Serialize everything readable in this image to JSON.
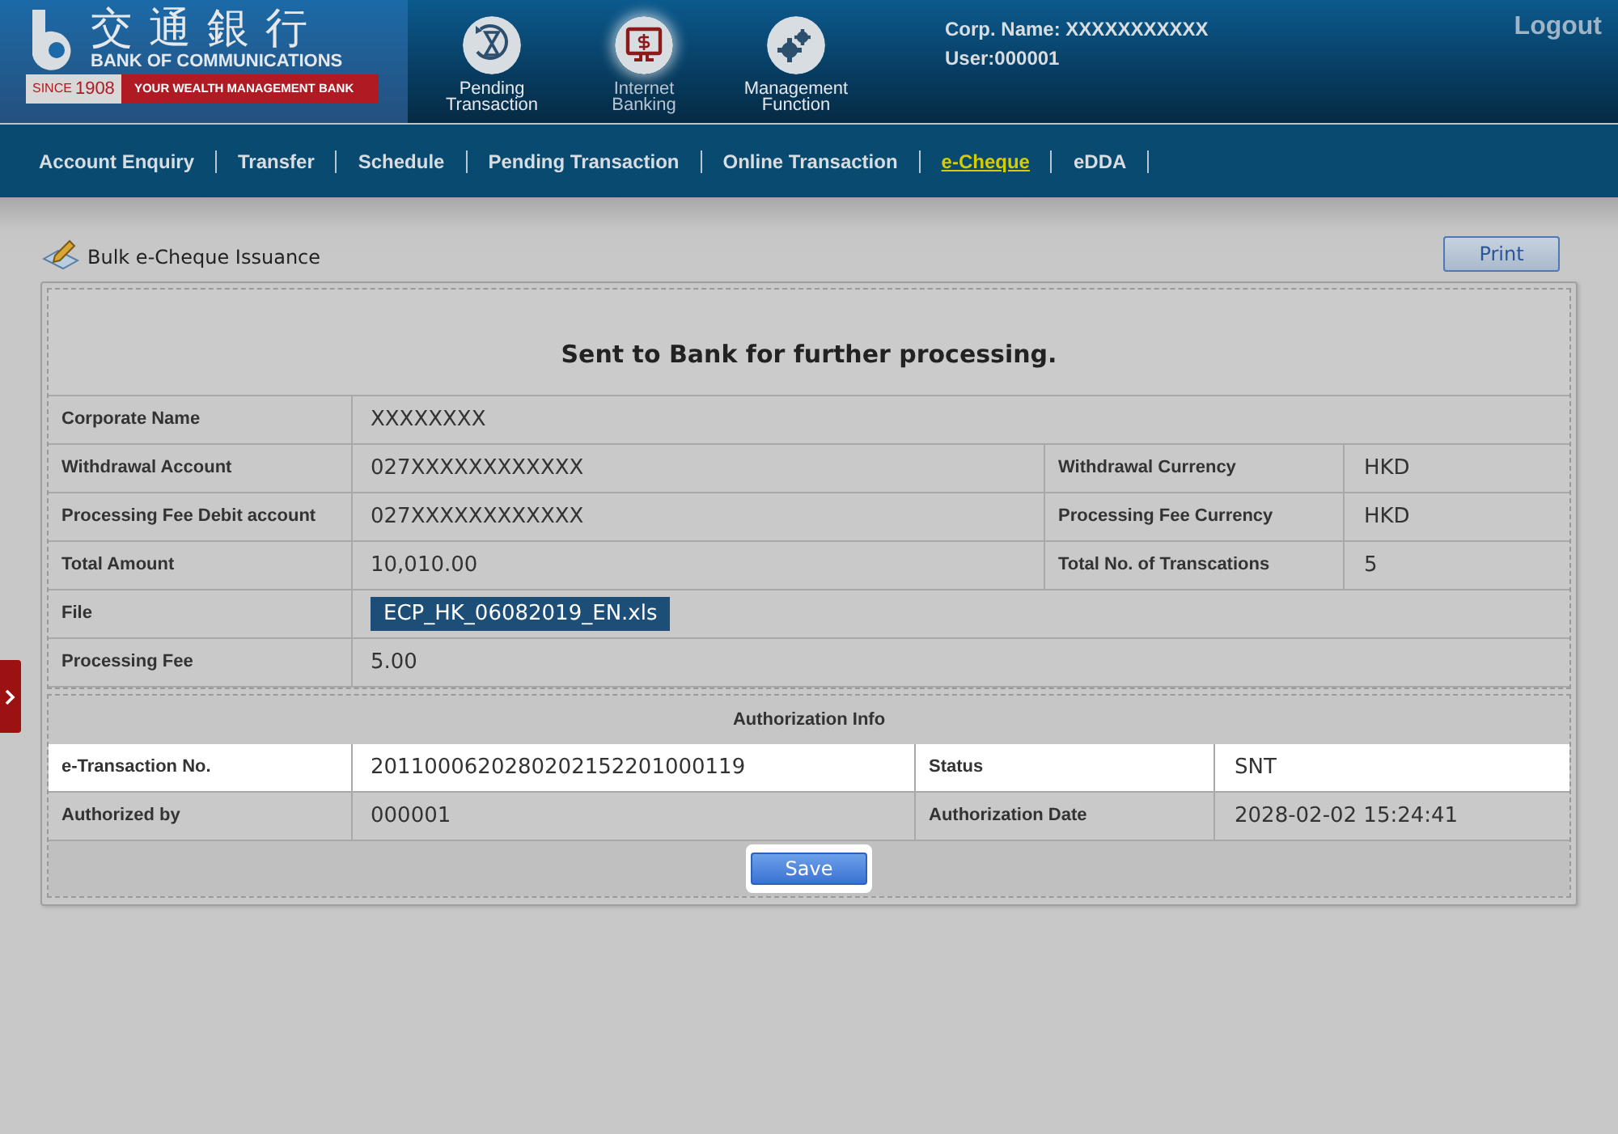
{
  "header": {
    "logo": {
      "chinese": "交通銀行",
      "english": "BANK OF COMMUNICATIONS",
      "since": "SINCE",
      "year": "1908",
      "slogan": "YOUR WEALTH MANAGEMENT BANK"
    },
    "shortcuts": [
      {
        "label": "Pending Transaction",
        "kind": "hourglass",
        "selected": false
      },
      {
        "label": "Internet Banking",
        "kind": "monitor",
        "selected": true
      },
      {
        "label": "Management Function",
        "kind": "gears",
        "selected": false
      }
    ],
    "corp_name": "Corp. Name: XXXXXXXXXXX",
    "user": "User:000001",
    "logout": "Logout"
  },
  "nav": [
    {
      "label": "Account Enquiry",
      "selected": false
    },
    {
      "label": "Transfer",
      "selected": false
    },
    {
      "label": "Schedule",
      "selected": false
    },
    {
      "label": "Pending Transaction",
      "selected": false
    },
    {
      "label": "Online Transaction",
      "selected": false
    },
    {
      "label": "e-Cheque",
      "selected": true
    },
    {
      "label": "eDDA",
      "selected": false
    }
  ],
  "page": {
    "title": "Bulk e-Cheque Issuance",
    "print": "Print"
  },
  "result": {
    "message": "Sent to Bank for further processing.",
    "rows": [
      {
        "kind": "text",
        "label": "Corporate Name",
        "value": "XXXXXXXX"
      },
      {
        "kind": "text",
        "label": "Withdrawal Account",
        "value": "027XXXXXXXXXXXX",
        "label_2": "Withdrawal Currency",
        "value_2": "HKD"
      },
      {
        "kind": "text",
        "label": "Processing Fee Debit account",
        "value": "027XXXXXXXXXXXX",
        "label_2": "Processing Fee Currency",
        "value_2": "HKD"
      },
      {
        "kind": "text",
        "label": "Total Amount",
        "value": "10,010.00",
        "label_2": "Total No. of Transcations",
        "value_2": "5"
      },
      {
        "kind": "file",
        "label": "File",
        "value": "ECP_HK_06082019_EN.xls"
      },
      {
        "kind": "text",
        "label": "Processing Fee",
        "value": "5.00"
      }
    ]
  },
  "authorization": {
    "title": "Authorization Info",
    "rows": [
      {
        "label": "e-Transaction No.",
        "value": "2011000620280202152201000119",
        "label_2": "Status",
        "value_2": "SNT",
        "highlighted": true
      },
      {
        "label": "Authorized by",
        "value": "000001",
        "label_2": "Authorization Date",
        "value_2": "2028-02-02 15:24:41",
        "highlighted": false
      }
    ],
    "save": "Save"
  }
}
